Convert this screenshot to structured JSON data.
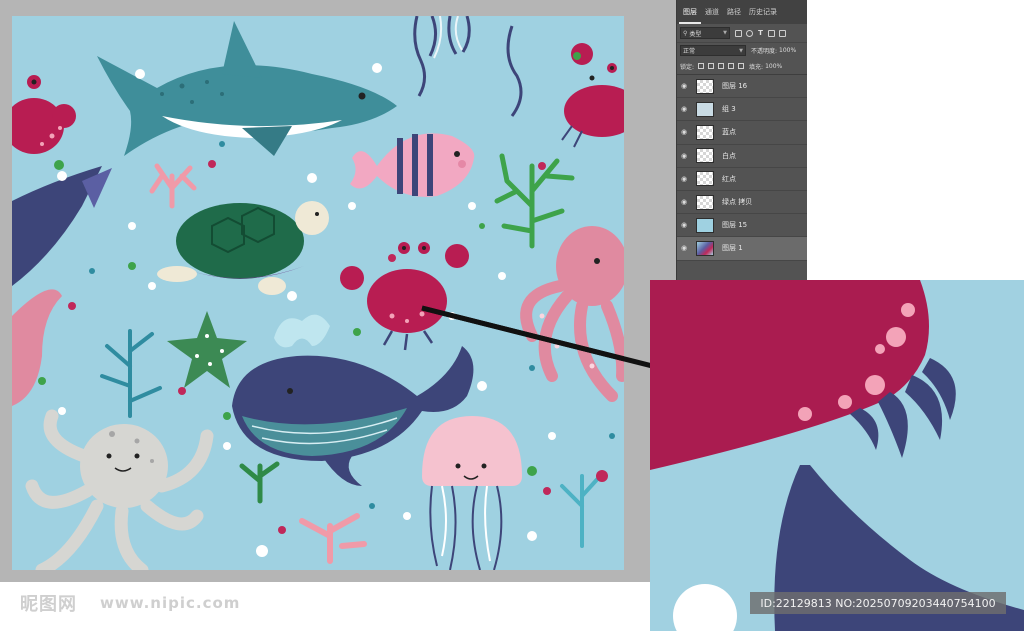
{
  "panel": {
    "tabs": [
      {
        "label": "图层",
        "active": true
      },
      {
        "label": "通道",
        "active": false
      },
      {
        "label": "路径",
        "active": false
      },
      {
        "label": "历史记录",
        "active": false
      }
    ],
    "filter_label": "类型",
    "blend_mode": "正常",
    "opacity_label": "不透明度:",
    "opacity_value": "100%",
    "lock_label": "锁定:",
    "fill_label": "填充:",
    "fill_value": "100%",
    "layers": [
      {
        "name": "图层 16",
        "thumb": "transparent",
        "selected": false
      },
      {
        "name": "组 3",
        "thumb": "group",
        "selected": false
      },
      {
        "name": "蓝点",
        "thumb": "transparent",
        "selected": false
      },
      {
        "name": "白点",
        "thumb": "transparent",
        "selected": false
      },
      {
        "name": "红点",
        "thumb": "transparent",
        "selected": false
      },
      {
        "name": "绿点 拷贝",
        "thumb": "transparent",
        "selected": false
      },
      {
        "name": "图层 15",
        "thumb": "solid",
        "selected": false
      },
      {
        "name": "图层 1",
        "thumb": "art",
        "selected": true
      }
    ]
  },
  "watermark": {
    "logo": "昵图网",
    "url": "www.nipic.com"
  },
  "image_id": "ID:22129813 NO:20250709203440754100",
  "colors": {
    "ocean": "#9fd1e1",
    "shark": "#3f8e9a",
    "crab": "#b81d52",
    "whale": "#3d4579",
    "octopus_pink": "#e08aa0",
    "octopus_gray": "#d6d6d2",
    "jelly": "#f5c2cf",
    "coral_green": "#3ea34a"
  }
}
